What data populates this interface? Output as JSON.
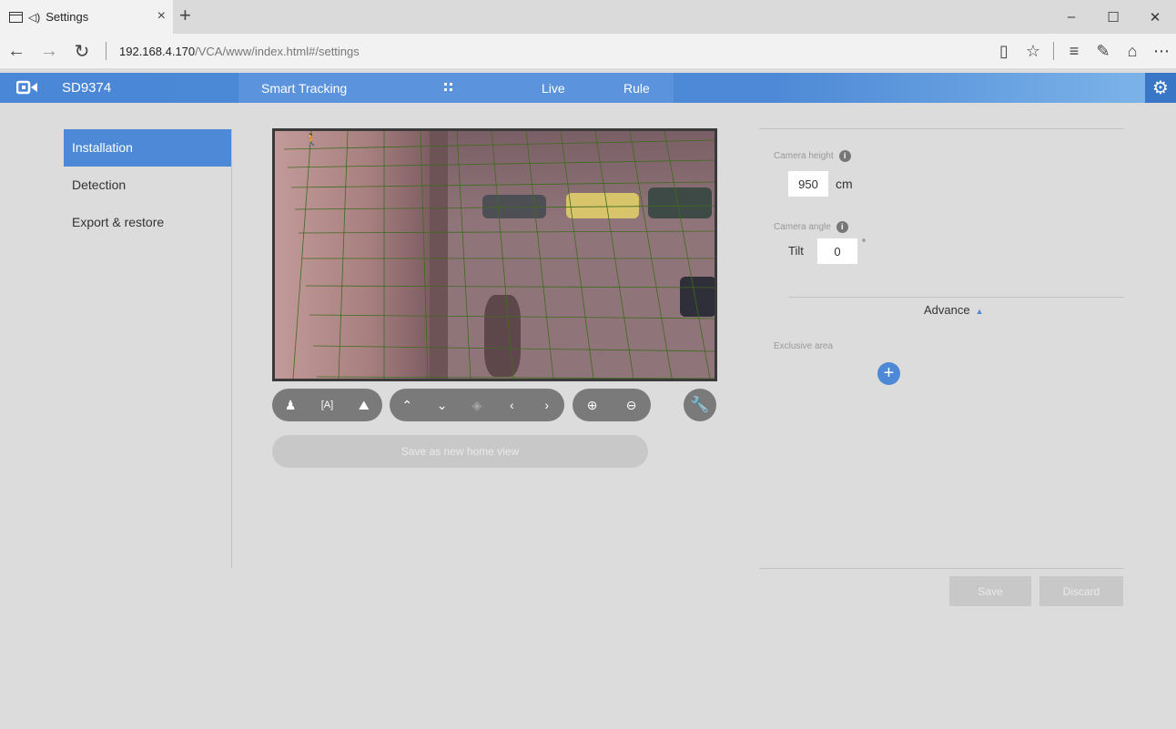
{
  "browser": {
    "tab_title": "Settings",
    "tab_close": "×",
    "new_tab": "+",
    "url_host": "192.168.4.170",
    "url_path": "/VCA/www/index.html#/settings",
    "window_controls": [
      "–",
      "☐",
      "✕"
    ]
  },
  "app": {
    "model": "SD9374",
    "nav": {
      "smart_tracking": "Smart Tracking",
      "live": "Live",
      "rule": "Rule"
    }
  },
  "sidebar": {
    "items": [
      {
        "label": "Installation",
        "active": true
      },
      {
        "label": "Detection",
        "active": false
      },
      {
        "label": "Export & restore",
        "active": false
      }
    ]
  },
  "camera": {
    "save_home_label": "Save as new home view",
    "controls": {
      "view_mode": [
        "person-icon",
        "focus-a-icon",
        "landscape-icon"
      ],
      "ptz": [
        "up-arrow-icon",
        "down-arrow-icon",
        "center-icon",
        "left-arrow-icon",
        "right-arrow-icon"
      ],
      "zoom": [
        "zoom-in-icon",
        "zoom-out-icon"
      ],
      "tools": "wrench-icon"
    }
  },
  "settings": {
    "camera_height_label": "Camera height",
    "camera_height_value": "950",
    "camera_height_unit": "cm",
    "camera_angle_label": "Camera angle",
    "tilt_label": "Tilt",
    "tilt_value": "0",
    "tilt_unit": "°",
    "advance_label": "Advance",
    "exclusive_area_label": "Exclusive area"
  },
  "actions": {
    "save": "Save",
    "discard": "Discard"
  },
  "colors": {
    "accent": "#4d89d6",
    "header_end": "#7fb6ea",
    "background": "#dcdcdc",
    "disabled_button": "#c8c8c8"
  }
}
